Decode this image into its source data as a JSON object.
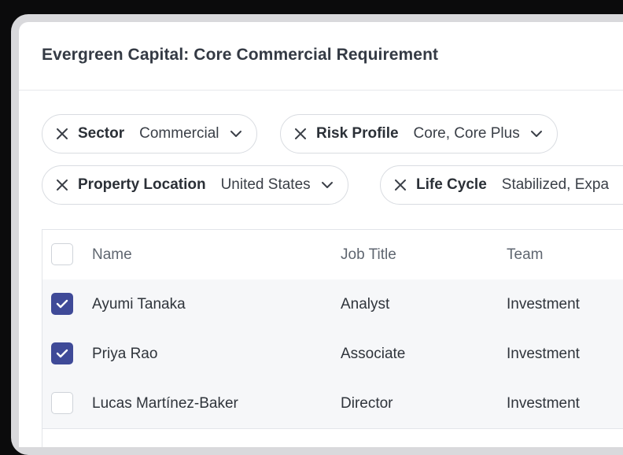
{
  "header": {
    "title": "Evergreen Capital: Core Commercial Requirement"
  },
  "filters": [
    {
      "label": "Sector",
      "value": "Commercial"
    },
    {
      "label": "Risk Profile",
      "value": "Core, Core Plus"
    },
    {
      "label": "Property Location",
      "value": "United States"
    },
    {
      "label": "Life Cycle",
      "value": "Stabilized, Expa"
    }
  ],
  "table": {
    "columns": [
      "Name",
      "Job Title",
      "Team"
    ],
    "rows": [
      {
        "name": "Ayumi Tanaka",
        "job_title": "Analyst",
        "team": "Investment",
        "selected": true
      },
      {
        "name": "Priya Rao",
        "job_title": "Associate",
        "team": "Investment",
        "selected": true
      },
      {
        "name": "Lucas Martínez-Baker",
        "job_title": "Director",
        "team": "Investment",
        "selected": false
      }
    ]
  },
  "colors": {
    "checkbox_accent": "#3f4a98",
    "row_background": "#f6f7f9"
  }
}
